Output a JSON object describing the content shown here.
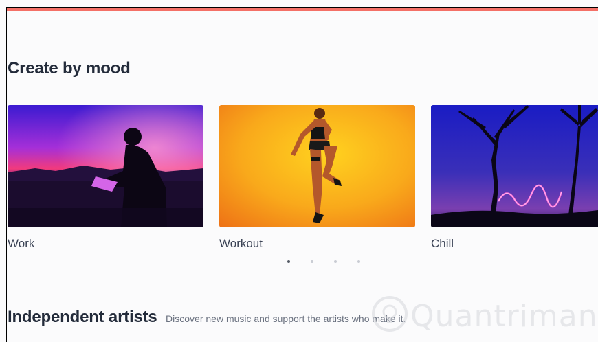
{
  "colors": {
    "accent": "#f47067",
    "heading": "#232b3a",
    "label": "#3b4355"
  },
  "mood_section": {
    "title": "Create by mood",
    "cards": [
      {
        "label": "Work"
      },
      {
        "label": "Workout"
      },
      {
        "label": "Chill"
      }
    ],
    "carousel": {
      "pages": 4,
      "active_page": 1
    }
  },
  "artists_section": {
    "title": "Independent artists",
    "subtitle": "Discover new music and support the artists who make it."
  },
  "watermark": {
    "text": "Quantrimang"
  }
}
